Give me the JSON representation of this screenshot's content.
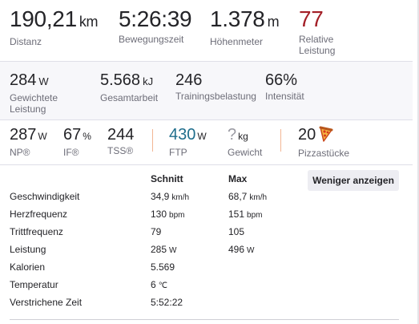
{
  "primary_stats": {
    "distance": {
      "value": "190,21",
      "unit": "km",
      "label": "Distanz"
    },
    "moving_time": {
      "value": "5:26:39",
      "label": "Bewegungszeit"
    },
    "elevation": {
      "value": "1.378",
      "unit": "m",
      "label": "Höhenmeter"
    },
    "relative_effort": {
      "value": "77",
      "label": "Relative Leistung",
      "color": "#a31f27"
    }
  },
  "secondary_stats": {
    "weighted_power": {
      "value": "284",
      "unit": "W",
      "label": "Gewichtete Leistung"
    },
    "total_work": {
      "value": "5.568",
      "unit": "kJ",
      "label": "Gesamtarbeit"
    },
    "training_load": {
      "value": "246",
      "label": "Trainingsbelastung"
    },
    "intensity": {
      "value": "66%",
      "label": "Intensität"
    }
  },
  "tertiary_stats": {
    "np": {
      "value": "287",
      "unit": "W",
      "label": "NP®"
    },
    "if": {
      "value": "67",
      "unit": "%",
      "label": "IF®"
    },
    "tss": {
      "value": "244",
      "label": "TSS®"
    },
    "ftp": {
      "value": "430",
      "unit": "W",
      "label": "FTP",
      "color": "#1f6e8c"
    },
    "weight": {
      "value": "?",
      "unit": "kg",
      "label": "Gewicht"
    },
    "pizza": {
      "value": "20",
      "label": "Pizzastücke",
      "icon": "pizza-slice-icon"
    }
  },
  "details": {
    "header_avg": "Schnitt",
    "header_max": "Max",
    "toggle_button": "Weniger anzeigen",
    "rows": [
      {
        "name": "Geschwindigkeit",
        "avg": "34,9",
        "avg_unit": "km/h",
        "max": "68,7",
        "max_unit": "km/h"
      },
      {
        "name": "Herzfrequenz",
        "avg": "130",
        "avg_unit": "bpm",
        "max": "151",
        "max_unit": "bpm"
      },
      {
        "name": "Trittfrequenz",
        "avg": "79",
        "avg_unit": "",
        "max": "105",
        "max_unit": ""
      },
      {
        "name": "Leistung",
        "avg": "285",
        "avg_unit": "W",
        "max": "496",
        "max_unit": "W"
      },
      {
        "name": "Kalorien",
        "avg": "5.569",
        "avg_unit": "",
        "max": "",
        "max_unit": ""
      },
      {
        "name": "Temperatur",
        "avg": "6",
        "avg_unit": "℃",
        "max": "",
        "max_unit": ""
      },
      {
        "name": "Verstrichene Zeit",
        "avg": "5:52:22",
        "avg_unit": "",
        "max": "",
        "max_unit": ""
      }
    ]
  }
}
